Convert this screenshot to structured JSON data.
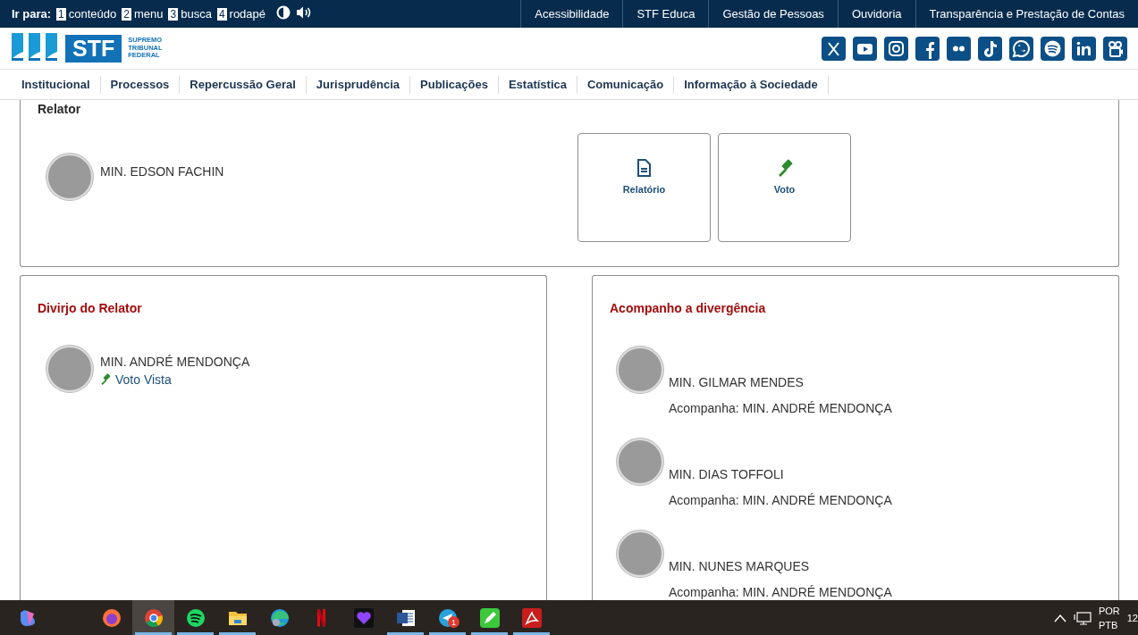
{
  "top_bar": {
    "label": "Ir para:",
    "skip_links": [
      {
        "key": "1",
        "label": "conteúdo"
      },
      {
        "key": "2",
        "label": "menu"
      },
      {
        "key": "3",
        "label": "busca"
      },
      {
        "key": "4",
        "label": "rodapé"
      }
    ],
    "links": [
      "Acessibilidade",
      "STF Educa",
      "Gestão de Pessoas",
      "Ouvidoria",
      "Transparência e Prestação de Contas"
    ]
  },
  "header": {
    "logo": {
      "mark": "STF",
      "lines": [
        "SUPREMO",
        "TRIBUNAL",
        "FEDERAL"
      ]
    },
    "social": [
      {
        "kind": "x"
      },
      {
        "kind": "play"
      },
      {
        "kind": "camera"
      },
      {
        "kind": "f"
      },
      {
        "kind": "dots"
      },
      {
        "kind": "note"
      },
      {
        "kind": "phone"
      },
      {
        "kind": "waves"
      },
      {
        "kind": "in"
      },
      {
        "kind": "film"
      }
    ]
  },
  "nav": [
    "Institucional",
    "Processos",
    "Repercussão Geral",
    "Jurisprudência",
    "Publicações",
    "Estatística",
    "Comunicação",
    "Informação à Sociedade"
  ],
  "relator": {
    "title": "Relator",
    "minister": "MIN. EDSON FACHIN",
    "documents": [
      {
        "kind": "document",
        "label": "Relatório"
      },
      {
        "kind": "gavel",
        "label": "Voto"
      }
    ]
  },
  "divergence": {
    "title": "Divirjo do Relator",
    "minister": "MIN. ANDRÉ MENDONÇA",
    "link": "Voto Vista"
  },
  "follow": {
    "title": "Acompanho a divergência",
    "ministers": [
      {
        "name": "MIN. GILMAR MENDES",
        "note": "Acompanha: MIN. ANDRÉ MENDONÇA"
      },
      {
        "name": "MIN. DIAS TOFFOLI",
        "note": "Acompanha: MIN. ANDRÉ MENDONÇA"
      },
      {
        "name": "MIN. NUNES MARQUES",
        "note": "Acompanha: MIN. ANDRÉ MENDONÇA"
      }
    ]
  },
  "taskbar": {
    "apps": [
      {
        "kind": "swirl",
        "selected": false,
        "running": false
      },
      {
        "kind": "firefox",
        "selected": false,
        "running": false
      },
      {
        "kind": "chrome",
        "selected": true,
        "running": true
      },
      {
        "kind": "spotify",
        "selected": false,
        "running": true
      },
      {
        "kind": "folder",
        "selected": false,
        "running": true
      },
      {
        "kind": "edge",
        "selected": false,
        "running": false
      },
      {
        "kind": "ribbon",
        "selected": false,
        "running": false
      },
      {
        "kind": "heart",
        "selected": false,
        "running": false
      },
      {
        "kind": "word",
        "selected": false,
        "running": true
      },
      {
        "kind": "plane",
        "selected": false,
        "running": true,
        "badge": "1"
      },
      {
        "kind": "pen",
        "selected": false,
        "running": true
      },
      {
        "kind": "pdf",
        "selected": false,
        "running": true
      }
    ],
    "tray": {
      "lang": "POR",
      "layout": "PTB",
      "clock": "12"
    }
  }
}
